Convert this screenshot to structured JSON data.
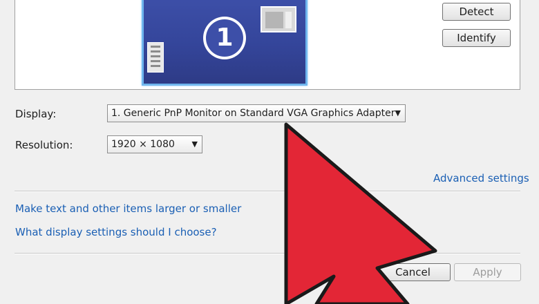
{
  "preview": {
    "monitor_number": "1",
    "detect_label": "Detect",
    "identify_label": "Identify"
  },
  "display_row": {
    "label": "Display:",
    "selected": "1. Generic PnP Monitor on Standard VGA Graphics Adapter"
  },
  "resolution_row": {
    "label": "Resolution:",
    "selected": "1920 × 1080"
  },
  "links": {
    "advanced": "Advanced settings",
    "text_size": "Make text and other items larger or smaller",
    "help": "What display settings should I choose?"
  },
  "footer": {
    "cancel_label": "Cancel",
    "apply_label": "Apply"
  },
  "colors": {
    "link": "#1a5fb4",
    "arrow_fill": "#e32636",
    "monitor_blue": "#3d4fa8"
  }
}
